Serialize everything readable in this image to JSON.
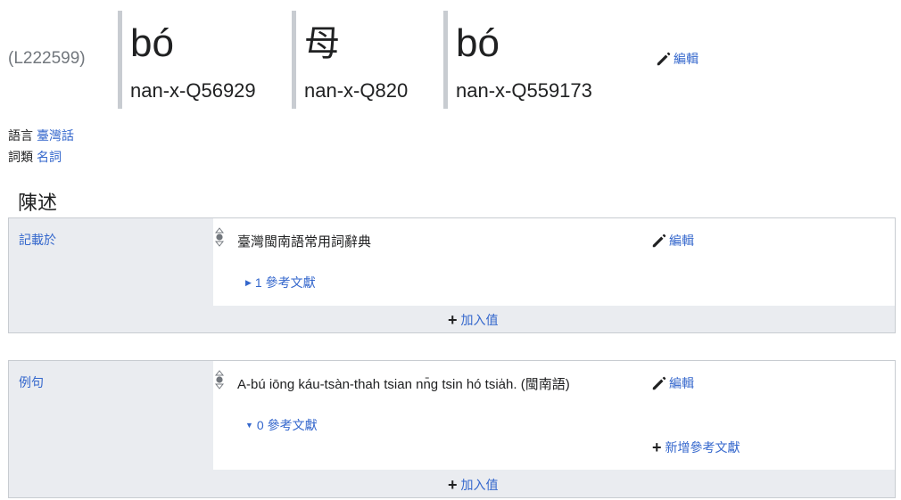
{
  "lexeme": {
    "id": "(L222599)",
    "lemmas": [
      {
        "form": "bó",
        "code": "nan-x-Q56929"
      },
      {
        "form": "母",
        "code": "nan-x-Q820"
      },
      {
        "form": "bó",
        "code": "nan-x-Q559173"
      }
    ],
    "edit_label": "編輯"
  },
  "meta": {
    "language_label": "語言",
    "language_value": "臺灣話",
    "category_label": "詞類",
    "category_value": "名詞"
  },
  "section_title": "陳述",
  "statements": [
    {
      "property": "記載於",
      "value": "臺灣閩南語常用詞辭典",
      "edit_label": "編輯",
      "references_label": "1 參考文獻",
      "add_value_label": "加入值"
    },
    {
      "property": "例句",
      "value": "A-bú iōng káu-tsàn-thah tsian nn̄g tsin hó tsia̍h. (閩南語)",
      "edit_label": "編輯",
      "references_label": "0 參考文獻",
      "add_reference_label": "新增參考文獻",
      "add_value_label": "加入值"
    }
  ],
  "colors": {
    "link": "#3366cc",
    "border": "#c8ccd1",
    "section_bg": "#eaecf0"
  }
}
